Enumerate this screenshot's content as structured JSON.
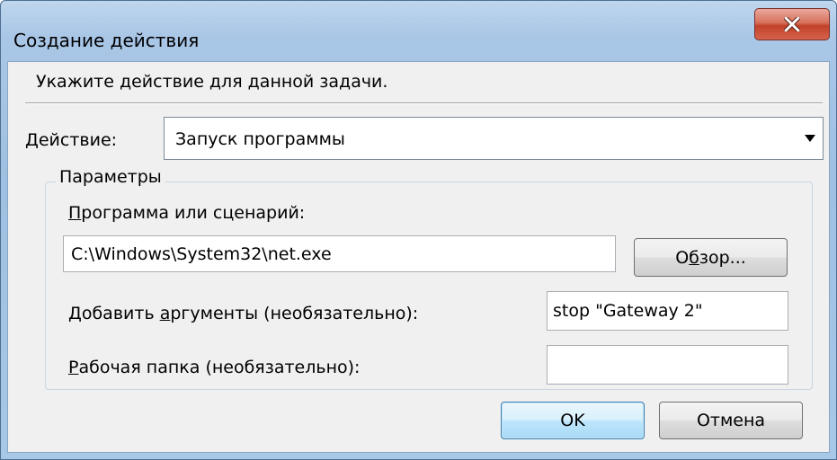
{
  "window": {
    "title": "Создание действия",
    "close_icon": "close-icon"
  },
  "instruction": "Укажите действие для данной задачи.",
  "action": {
    "label_underlined": "Д",
    "label_rest": "ействие:",
    "selected": "Запуск программы",
    "arrow_icon": "chevron-down-icon"
  },
  "parameters": {
    "caption": "Параметры",
    "program": {
      "label_underlined": "П",
      "label_rest": "рограмма или сценарий:",
      "value": "C:\\Windows\\System32\\net.exe"
    },
    "browse": {
      "label_pre": "О",
      "label_underlined": "б",
      "label_post": "зор..."
    },
    "arguments": {
      "label_pre": "Добавить ",
      "label_underlined": "а",
      "label_post": "ргументы (необязательно):",
      "value": "stop \"Gateway 2\""
    },
    "workdir": {
      "label_underlined": "Р",
      "label_rest": "абочая папка (необязательно):",
      "value": ""
    }
  },
  "buttons": {
    "ok": "OK",
    "cancel": "Отмена"
  },
  "colors": {
    "close_button": "#c4412a",
    "ok_border": "#3c7fb1"
  }
}
